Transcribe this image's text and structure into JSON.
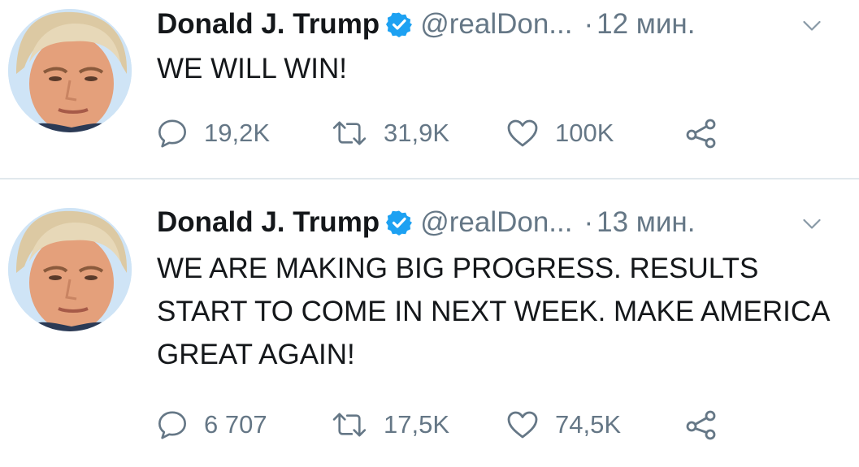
{
  "tweets": [
    {
      "name": "Donald J. Trump",
      "handle": "@realDon...",
      "separator": "·",
      "time": "12 мин.",
      "text": "WE WILL WIN!",
      "replies": "19,2K",
      "retweets": "31,9K",
      "likes": "100K"
    },
    {
      "name": "Donald J. Trump",
      "handle": "@realDon...",
      "separator": "·",
      "time": "13 мин.",
      "text": "WE ARE MAKING BIG PROGRESS. RESULTS START TO COME IN NEXT WEEK. MAKE AMERICA GREAT AGAIN!",
      "replies": "6 707",
      "retweets": "17,5K",
      "likes": "74,5K"
    }
  ],
  "icons": {
    "verified": "verified-badge-icon",
    "caret": "chevron-down-icon",
    "reply": "reply-icon",
    "retweet": "retweet-icon",
    "like": "heart-icon",
    "share": "share-icon"
  },
  "colors": {
    "accent": "#1da1f2",
    "text": "#14171a",
    "secondary": "#657786",
    "divider": "#e1e8ed"
  }
}
